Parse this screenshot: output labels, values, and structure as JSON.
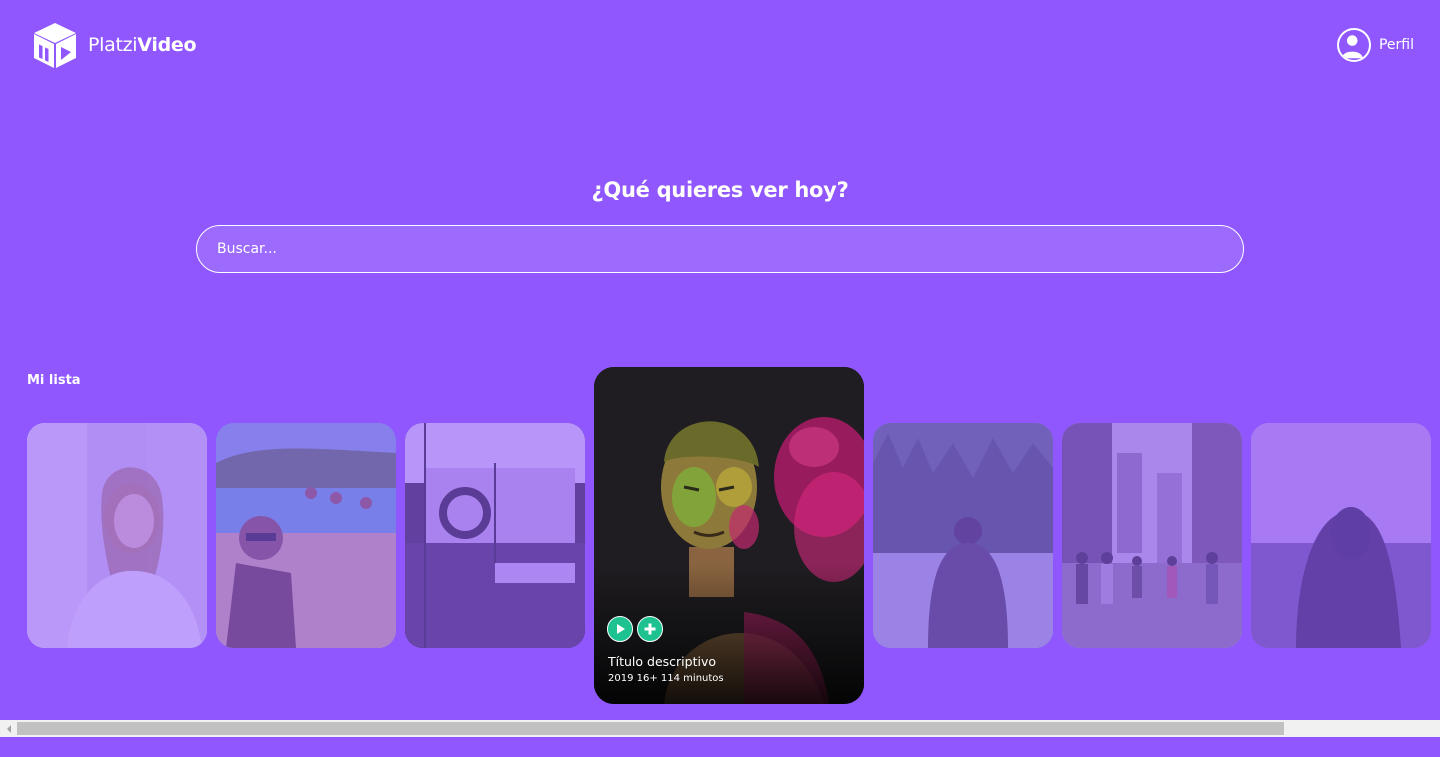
{
  "brand": {
    "name_light": "Platzi",
    "name_bold": "Video",
    "logo_icon": "cube-play-icon"
  },
  "header": {
    "profile_label": "Perfil",
    "profile_icon": "user-avatar-icon"
  },
  "search": {
    "title": "¿Qué quieres ver hoy?",
    "placeholder": "Buscar..."
  },
  "carousel": {
    "title": "Mi lista",
    "items": [
      {
        "image": "woman-smiling-phone"
      },
      {
        "image": "friends-beach-selfie"
      },
      {
        "image": "restaurant-interior"
      },
      {
        "image": "man-holi-powder",
        "title": "Título descriptivo",
        "meta": "2019 16+ 114 minutos"
      },
      {
        "image": "person-forest-lake"
      },
      {
        "image": "city-street-crowd"
      },
      {
        "image": "hooded-person-sea"
      }
    ],
    "actions": {
      "play_icon": "play-icon",
      "add_icon": "plus-icon"
    }
  },
  "colors": {
    "background": "#8f57fd",
    "accent": "#1ec290",
    "text": "#ffffff"
  }
}
